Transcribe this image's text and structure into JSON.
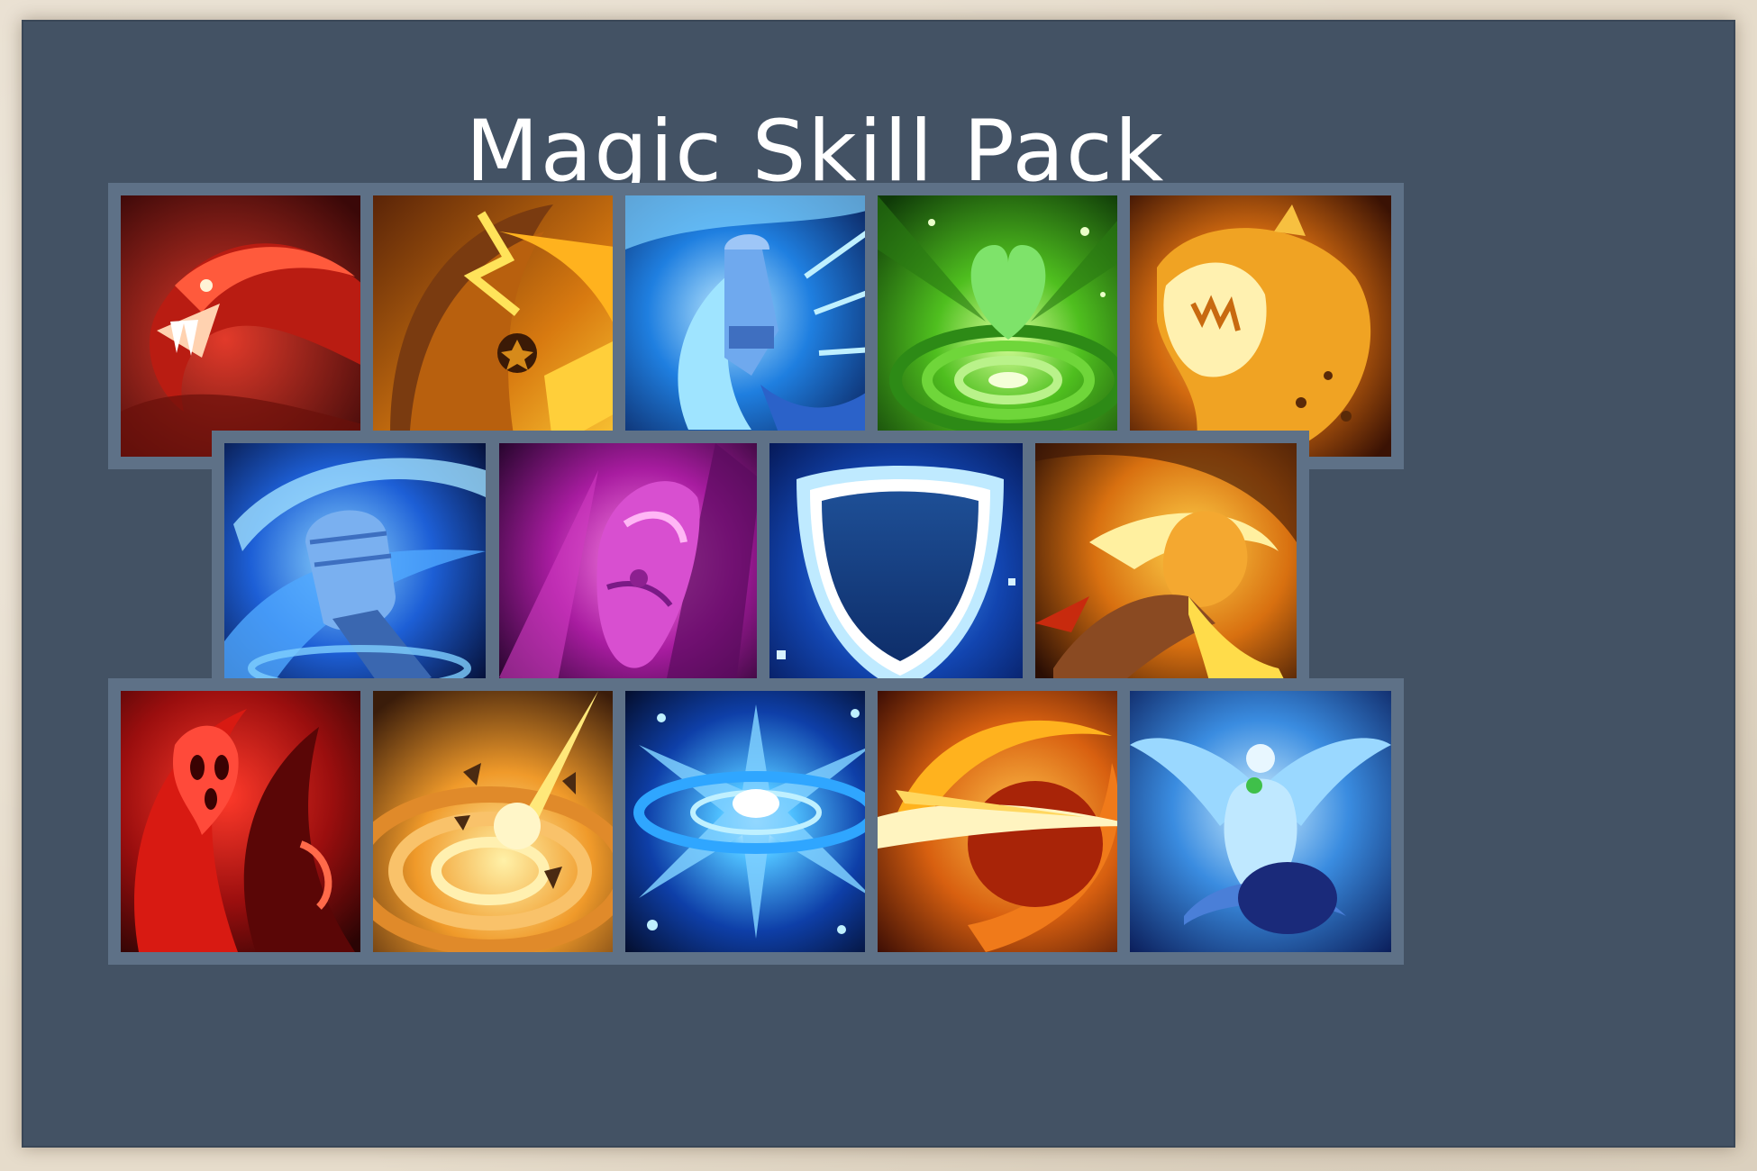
{
  "title": "Magic Skill Pack",
  "grid": {
    "rows": [
      [
        "serpent-bite-icon",
        "flame-blast-icon",
        "ice-kick-icon",
        "heal-heart-icon",
        "fire-beast-icon"
      ],
      [
        "frost-punch-icon",
        "arcane-punch-icon",
        "arcane-shield-icon",
        "fire-punch-icon"
      ],
      [
        "blood-spirit-icon",
        "meteor-impact-icon",
        "ice-nova-icon",
        "fire-slash-icon",
        "frost-phoenix-icon"
      ]
    ]
  },
  "colors": {
    "panel": "#435264",
    "slot_frame": "#5e7187",
    "paper": "#e6dccb",
    "title": "#ffffff"
  }
}
